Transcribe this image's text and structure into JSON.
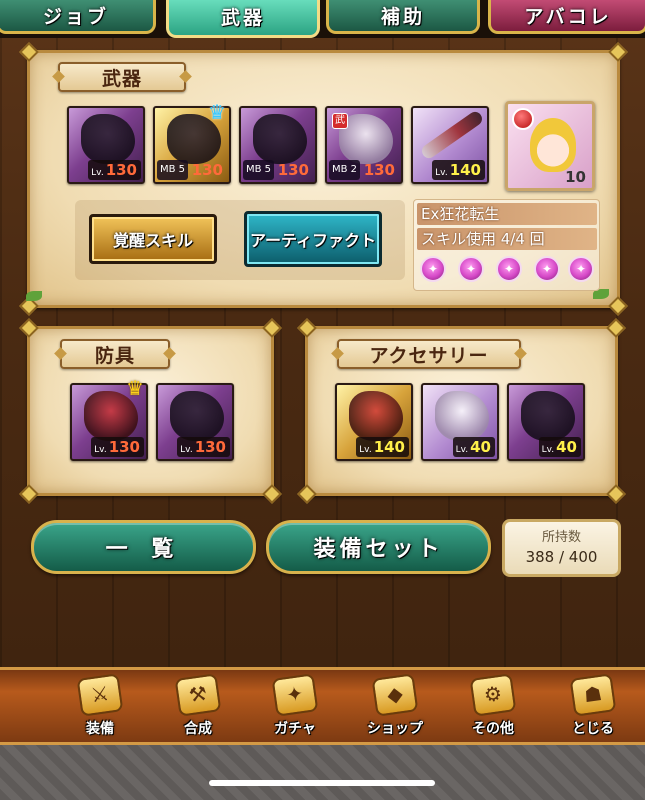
{
  "tabs": [
    {
      "label": "ジョブ"
    },
    {
      "label": "武器"
    },
    {
      "label": "補助"
    },
    {
      "label": "アバコレ"
    }
  ],
  "weapon_panel": {
    "title": "武器",
    "items": [
      {
        "lv_prefix": "Lv.",
        "level": "130"
      },
      {
        "mb": "MB 5",
        "level": "130",
        "crown": "♛"
      },
      {
        "mb": "MB 5",
        "level": "130"
      },
      {
        "mb": "MB 2",
        "level": "130",
        "badge": "武"
      },
      {
        "lv_prefix": "Lv.",
        "level": "140"
      }
    ],
    "character": {
      "count": "10"
    },
    "buttons": {
      "awaken_skill": "覚醒スキル",
      "artifact": "アーティファクト"
    },
    "ex_skill": {
      "name": "Ex狂花転生",
      "usage": "スキル使用 4/4 回"
    },
    "orb_count": 5
  },
  "armor_panel": {
    "title": "防具",
    "items": [
      {
        "lv_prefix": "Lv.",
        "level": "130",
        "crown": "♛"
      },
      {
        "lv_prefix": "Lv.",
        "level": "130"
      }
    ]
  },
  "accessory_panel": {
    "title": "アクセサリー",
    "items": [
      {
        "lv_prefix": "Lv.",
        "level": "140"
      },
      {
        "lv_prefix": "Lv.",
        "level": "40"
      },
      {
        "lv_prefix": "Lv.",
        "level": "40"
      }
    ]
  },
  "actions": {
    "list": "一 覧",
    "equip_set": "装備セット",
    "possession_label": "所持数",
    "possession_value": "388 / 400"
  },
  "nav": [
    {
      "label": "装備",
      "icon": "equipment-icon"
    },
    {
      "label": "合成",
      "icon": "hammer-icon"
    },
    {
      "label": "ガチャ",
      "icon": "gacha-icon"
    },
    {
      "label": "ショップ",
      "icon": "crystal-icon"
    },
    {
      "label": "その他",
      "icon": "gear-icon"
    },
    {
      "label": "とじる",
      "icon": "close-icon"
    }
  ],
  "colors": {
    "accent_teal": "#2ca483",
    "panel_bg": "#f0dcb2",
    "level_red": "#ff6a3a",
    "level_yellow": "#fff04a"
  }
}
